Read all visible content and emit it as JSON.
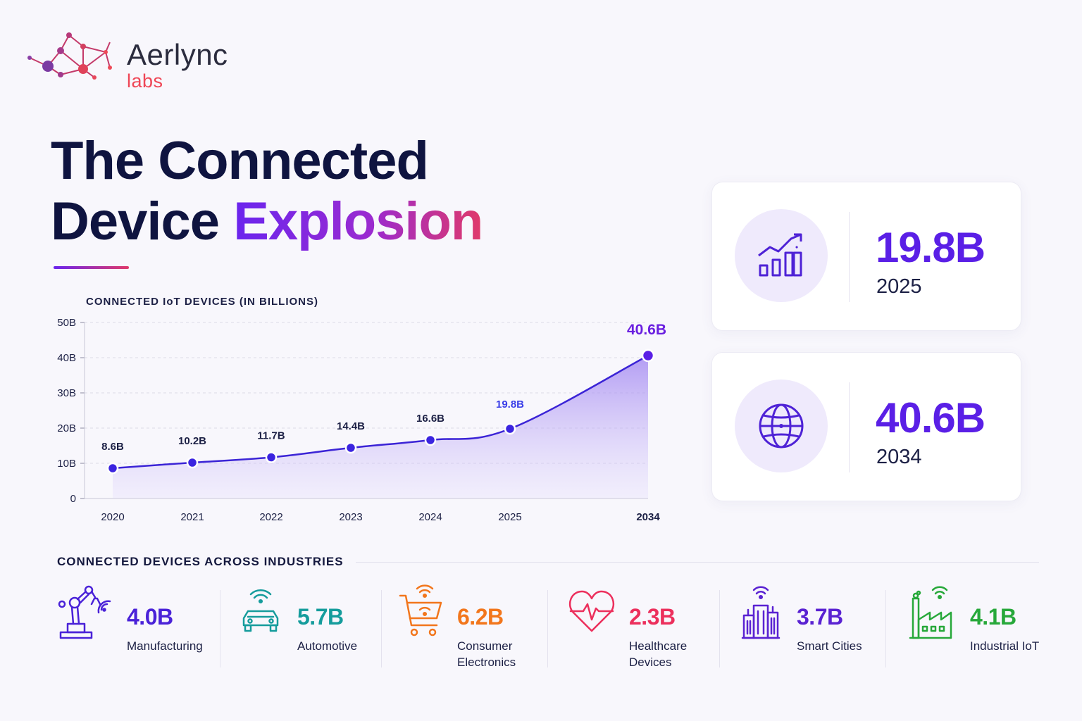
{
  "brand": {
    "name": "Aerlync",
    "sub": "labs"
  },
  "headline": {
    "line1": "The Connected",
    "line2_plain": "Device",
    "line2_accent": "Explosion"
  },
  "chart_data": {
    "type": "area",
    "title": "CONNECTED IoT DEVICES (IN BILLIONS)",
    "x": [
      "2020",
      "2021",
      "2022",
      "2023",
      "2024",
      "2025",
      "2034"
    ],
    "values": [
      8.6,
      10.2,
      11.7,
      14.4,
      16.6,
      19.8,
      40.6
    ],
    "point_labels": [
      "8.6B",
      "10.2B",
      "11.7B",
      "14.4B",
      "16.6B",
      "19.8B",
      "40.6B"
    ],
    "y_ticks": [
      "0",
      "10B",
      "20B",
      "30B",
      "40B",
      "50B"
    ],
    "ylim": [
      0,
      50
    ],
    "grid": true,
    "colors": {
      "line": "#3b24d6",
      "fill": "#a98af0",
      "highlight_2025": "#3b3fe8",
      "highlight_2034": "#6a1fe0"
    }
  },
  "stats": [
    {
      "value": "19.8B",
      "year": "2025",
      "icon": "growth-chart-icon"
    },
    {
      "value": "40.6B",
      "year": "2034",
      "icon": "globe-icon"
    }
  ],
  "industries_title": "CONNECTED DEVICES ACROSS INDUSTRIES",
  "industries": [
    {
      "value": "4.0B",
      "label": "Manufacturing",
      "color": "#4a22d8",
      "icon": "robot-arm-icon"
    },
    {
      "value": "5.7B",
      "label": "Automotive",
      "color": "#159c9c",
      "icon": "connected-car-icon"
    },
    {
      "value": "6.2B",
      "label": "Consumer Electronics",
      "color": "#f2761c",
      "icon": "shopping-cart-icon"
    },
    {
      "value": "2.3B",
      "label": "Healthcare Devices",
      "color": "#ec2f5c",
      "icon": "heartbeat-icon"
    },
    {
      "value": "3.7B",
      "label": "Smart Cities",
      "color": "#5a22d2",
      "icon": "city-buildings-icon"
    },
    {
      "value": "4.1B",
      "label": "Industrial IoT",
      "color": "#27a83a",
      "icon": "factory-icon"
    }
  ]
}
